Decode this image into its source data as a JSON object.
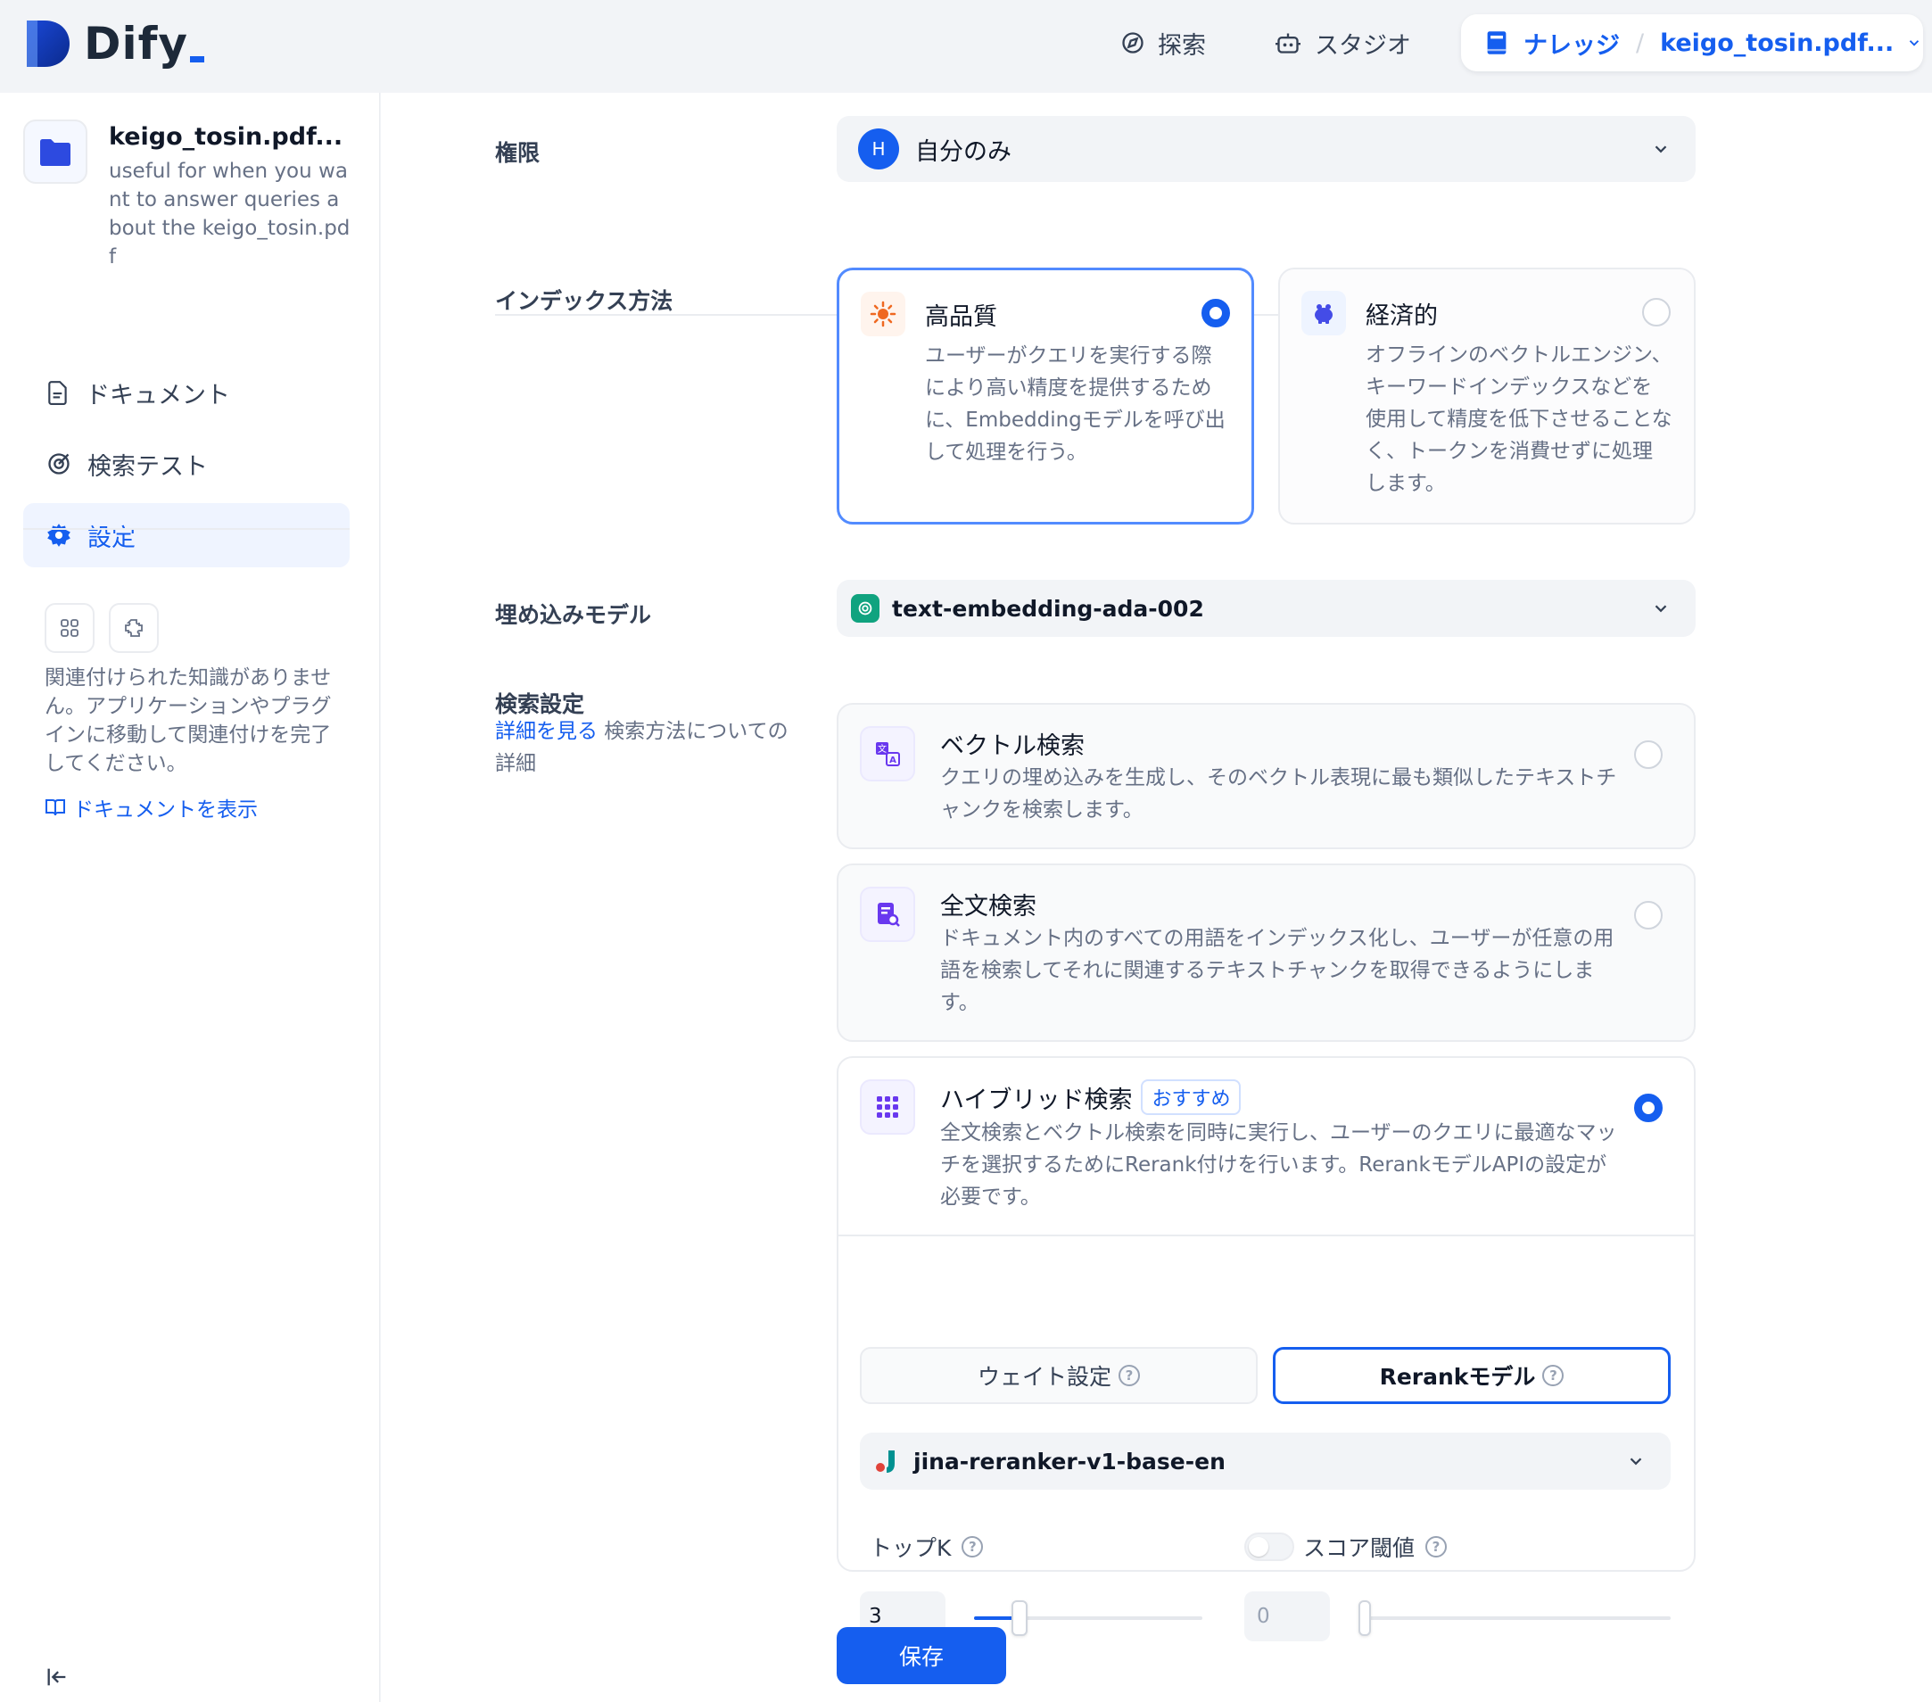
{
  "brand": {
    "name": "Dify"
  },
  "topnav": {
    "explore": "探索",
    "studio": "スタジオ",
    "knowledge": "ナレッジ",
    "separator": "/",
    "current": "keigo_tosin.pdf..."
  },
  "sidebar": {
    "dataset_name": "keigo_tosin.pdf...",
    "dataset_desc": "useful for when you want to answer queries about the keigo_tosin.pdf",
    "items": [
      {
        "label": "ドキュメント",
        "icon": "document-icon",
        "active": false
      },
      {
        "label": "検索テスト",
        "icon": "target-icon",
        "active": false
      },
      {
        "label": "設定",
        "icon": "gear-icon",
        "active": true
      }
    ],
    "note": "関連付けられた知識がありません。アプリケーションやプラグインに移動して関連付けを完了してください。",
    "docs_link": "ドキュメントを表示"
  },
  "settings": {
    "permission": {
      "label": "権限",
      "avatar": "H",
      "value": "自分のみ"
    },
    "index_method": {
      "label": "インデックス方法",
      "options": [
        {
          "title": "高品質",
          "desc": "ユーザーがクエリを実行する際により高い精度を提供するために、Embeddingモデルを呼び出して処理を行う。",
          "selected": true
        },
        {
          "title": "経済的",
          "desc": "オフラインのベクトルエンジン、キーワードインデックスなどを使用して精度を低下させることなく、トークンを消費せずに処理します。",
          "selected": false
        }
      ]
    },
    "embedding": {
      "label": "埋め込みモデル",
      "value": "text-embedding-ada-002"
    },
    "retrieval": {
      "label": "検索設定",
      "learn_more": "詳細を見る",
      "learn_more_suffix": " 検索方法についての詳細",
      "options": [
        {
          "title": "ベクトル検索",
          "desc": "クエリの埋め込みを生成し、そのベクトル表現に最も類似したテキストチャンクを検索します。",
          "selected": false
        },
        {
          "title": "全文検索",
          "desc": "ドキュメント内のすべての用語をインデックス化し、ユーザーが任意の用語を検索してそれに関連するテキストチャンクを取得できるようにします。",
          "selected": false
        },
        {
          "title": "ハイブリッド検索",
          "badge": "おすすめ",
          "desc": "全文検索とベクトル検索を同時に実行し、ユーザーのクエリに最適なマッチを選択するためにRerank付けを行います。RerankモデルAPIの設定が必要です。",
          "selected": true
        }
      ],
      "tabs": [
        {
          "label": "ウェイト設定",
          "active": false
        },
        {
          "label": "Rerankモデル",
          "active": true
        }
      ],
      "rerank_model": "jina-reranker-v1-base-en",
      "top_k": {
        "label": "トップK",
        "value": "3",
        "fraction": 0.2
      },
      "score_threshold": {
        "label": "スコア閾値",
        "value": "0",
        "enabled": false,
        "fraction": 0.0
      }
    },
    "save": "保存"
  },
  "colors": {
    "primary": "#155eef",
    "primary_light": "#eff4ff",
    "border": "#eaecf0"
  }
}
